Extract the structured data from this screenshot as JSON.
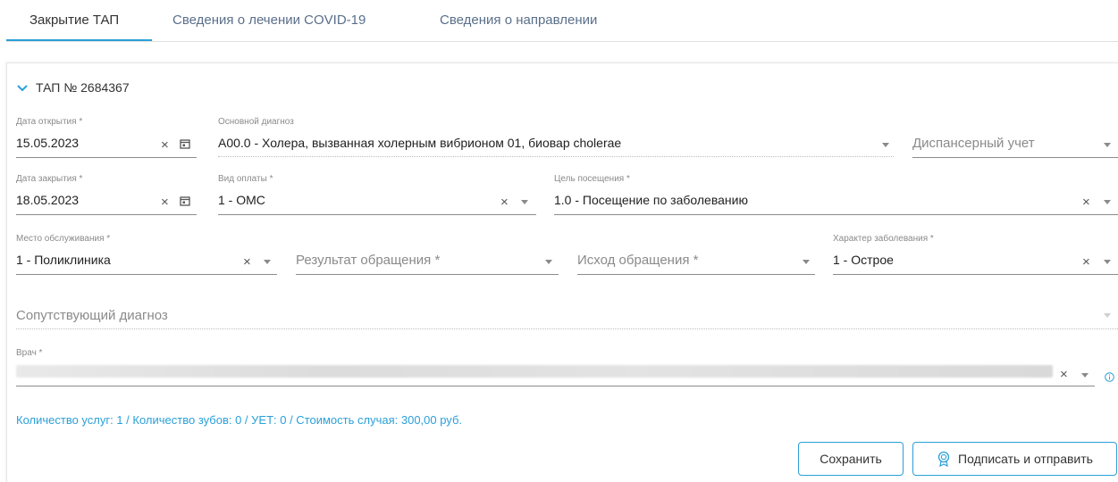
{
  "tabs": [
    {
      "label": "Закрытие ТАП",
      "active": true
    },
    {
      "label": "Сведения о лечении COVID-19",
      "active": false
    },
    {
      "label": "Сведения о направлении",
      "active": false
    }
  ],
  "section": {
    "title": "ТАП № 2684367"
  },
  "fields": {
    "open_date": {
      "label": "Дата открытия *",
      "value": "15.05.2023"
    },
    "main_diagnosis": {
      "label": "Основной диагноз",
      "value": "A00.0 - Холера, вызванная холерным вибрионом 01, биовар cholerae"
    },
    "dispensary": {
      "placeholder": "Диспансерный учет"
    },
    "close_date": {
      "label": "Дата закрытия *",
      "value": "18.05.2023"
    },
    "payment_type": {
      "label": "Вид оплаты *",
      "value": "1 - ОМС"
    },
    "visit_purpose": {
      "label": "Цель посещения *",
      "value": "1.0 - Посещение по заболеванию"
    },
    "service_place": {
      "label": "Место обслуживания *",
      "value": "1 - Поликлиника"
    },
    "appeal_result": {
      "placeholder": "Результат обращения *"
    },
    "appeal_outcome": {
      "placeholder": "Исход обращения *"
    },
    "disease_nature": {
      "label": "Характер заболевания *",
      "value": "1 - Острое"
    },
    "concomitant_diagnosis": {
      "placeholder": "Сопутствующий диагноз"
    },
    "doctor": {
      "label": "Врач *"
    }
  },
  "summary": "Количество услуг: 1 / Количество зубов: 0 / УЕТ: 0 / Стоимость случая: 300,00 руб.",
  "buttons": {
    "save": "Сохранить",
    "sign_send": "Подписать и отправить"
  },
  "colors": {
    "accent": "#2aa0d8",
    "tab_inactive": "#5a6f8a"
  },
  "icons": [
    "chevron-down-icon",
    "clear-icon",
    "calendar-icon",
    "dropdown-caret-icon",
    "info-icon",
    "certificate-icon"
  ]
}
